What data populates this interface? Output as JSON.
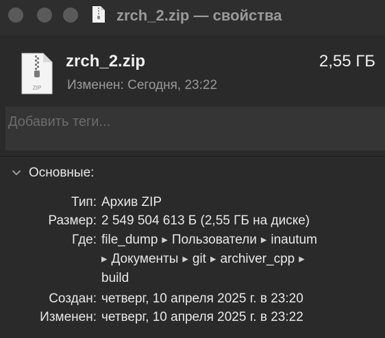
{
  "window": {
    "title": "zrch_2.zip — свойства"
  },
  "header": {
    "file_name": "zrch_2.zip",
    "file_size": "2,55 ГБ",
    "modified_label": "Изменен:",
    "modified_value": "Сегодня, 23:22",
    "icon_badge": "ZIP"
  },
  "tags": {
    "placeholder": "Добавить теги..."
  },
  "section": {
    "title": "Основные:",
    "expanded_icon": "chevron-down-icon"
  },
  "info": {
    "type_label": "Тип:",
    "type_value": "Архив ZIP",
    "size_label": "Размер:",
    "size_value": "2 549 504 613 Б (2,55 ГБ на диске)",
    "where_label": "Где:",
    "path": [
      "file_dump",
      "Пользователи",
      "inautum",
      "Документы",
      "git",
      "archiver_cpp",
      "build"
    ],
    "created_label": "Создан:",
    "created_value": "четверг, 10 апреля 2025 г. в 23:20",
    "modified_label": "Изменен:",
    "modified_value": "четверг, 10 апреля 2025 г. в 23:22"
  },
  "colors": {
    "window_bg": "#2a2a2a",
    "titlebar_bg": "#2e2e2e",
    "text_primary": "#e8e8e8",
    "text_secondary": "#9a9a9a"
  }
}
